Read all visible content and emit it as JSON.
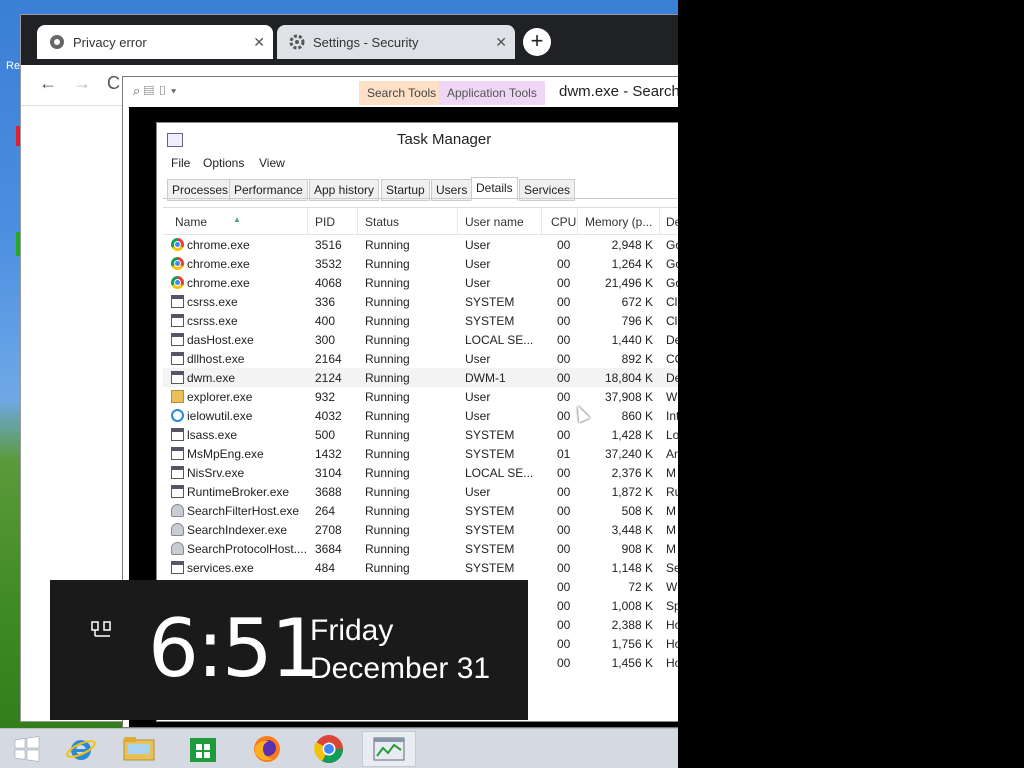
{
  "desktop": {
    "label": "Re"
  },
  "browser": {
    "tabs": [
      {
        "label": "Privacy error",
        "active": true
      },
      {
        "label": "Settings - Security",
        "active": false
      }
    ],
    "new_tab": "+",
    "nav": {
      "back": "←",
      "forward": "→",
      "reload": "C"
    }
  },
  "explorer": {
    "ribbon_tabs": [
      "Search Tools",
      "Application Tools"
    ],
    "title": "dwm.exe - Search"
  },
  "task_manager": {
    "title": "Task Manager",
    "menu": [
      "File",
      "Options",
      "View"
    ],
    "tabs": [
      "Processes",
      "Performance",
      "App history",
      "Startup",
      "Users",
      "Details",
      "Services"
    ],
    "active_tab": "Details",
    "columns": [
      "Name",
      "PID",
      "Status",
      "User name",
      "CPU",
      "Memory (p...",
      "De"
    ],
    "rows": [
      {
        "name": "chrome.exe",
        "icon": "chrome-icon",
        "pid": "3516",
        "status": "Running",
        "user": "User",
        "cpu": "00",
        "mem": "2,948 K",
        "desc": "Go"
      },
      {
        "name": "chrome.exe",
        "icon": "chrome-icon",
        "pid": "3532",
        "status": "Running",
        "user": "User",
        "cpu": "00",
        "mem": "1,264 K",
        "desc": "Go"
      },
      {
        "name": "chrome.exe",
        "icon": "chrome-icon",
        "pid": "4068",
        "status": "Running",
        "user": "User",
        "cpu": "00",
        "mem": "21,496 K",
        "desc": "Go"
      },
      {
        "name": "csrss.exe",
        "icon": "window-icon",
        "pid": "336",
        "status": "Running",
        "user": "SYSTEM",
        "cpu": "00",
        "mem": "672 K",
        "desc": "Cl"
      },
      {
        "name": "csrss.exe",
        "icon": "window-icon",
        "pid": "400",
        "status": "Running",
        "user": "SYSTEM",
        "cpu": "00",
        "mem": "796 K",
        "desc": "Cl"
      },
      {
        "name": "dasHost.exe",
        "icon": "window-icon",
        "pid": "300",
        "status": "Running",
        "user": "LOCAL SE...",
        "cpu": "00",
        "mem": "1,440 K",
        "desc": "De"
      },
      {
        "name": "dllhost.exe",
        "icon": "window-icon",
        "pid": "2164",
        "status": "Running",
        "user": "User",
        "cpu": "00",
        "mem": "892 K",
        "desc": "CO"
      },
      {
        "name": "dwm.exe",
        "icon": "window-icon",
        "pid": "2124",
        "status": "Running",
        "user": "DWM-1",
        "cpu": "00",
        "mem": "18,804 K",
        "desc": "De",
        "selected": true
      },
      {
        "name": "explorer.exe",
        "icon": "folder-icon",
        "pid": "932",
        "status": "Running",
        "user": "User",
        "cpu": "00",
        "mem": "37,908 K",
        "desc": "W"
      },
      {
        "name": "ielowutil.exe",
        "icon": "ie-icon",
        "pid": "4032",
        "status": "Running",
        "user": "User",
        "cpu": "00",
        "mem": "860 K",
        "desc": "Int"
      },
      {
        "name": "lsass.exe",
        "icon": "window-icon",
        "pid": "500",
        "status": "Running",
        "user": "SYSTEM",
        "cpu": "00",
        "mem": "1,428 K",
        "desc": "Lo"
      },
      {
        "name": "MsMpEng.exe",
        "icon": "window-icon",
        "pid": "1432",
        "status": "Running",
        "user": "SYSTEM",
        "cpu": "01",
        "mem": "37,240 K",
        "desc": "An"
      },
      {
        "name": "NisSrv.exe",
        "icon": "window-icon",
        "pid": "3104",
        "status": "Running",
        "user": "LOCAL SE...",
        "cpu": "00",
        "mem": "2,376 K",
        "desc": "M"
      },
      {
        "name": "RuntimeBroker.exe",
        "icon": "window-icon",
        "pid": "3688",
        "status": "Running",
        "user": "User",
        "cpu": "00",
        "mem": "1,872 K",
        "desc": "Ru"
      },
      {
        "name": "SearchFilterHost.exe",
        "icon": "person-icon",
        "pid": "264",
        "status": "Running",
        "user": "SYSTEM",
        "cpu": "00",
        "mem": "508 K",
        "desc": "M"
      },
      {
        "name": "SearchIndexer.exe",
        "icon": "person-icon",
        "pid": "2708",
        "status": "Running",
        "user": "SYSTEM",
        "cpu": "00",
        "mem": "3,448 K",
        "desc": "M"
      },
      {
        "name": "SearchProtocolHost....",
        "icon": "person-icon",
        "pid": "3684",
        "status": "Running",
        "user": "SYSTEM",
        "cpu": "00",
        "mem": "908 K",
        "desc": "M"
      },
      {
        "name": "services.exe",
        "icon": "window-icon",
        "pid": "484",
        "status": "Running",
        "user": "SYSTEM",
        "cpu": "00",
        "mem": "1,148 K",
        "desc": "Se"
      },
      {
        "name": "",
        "icon": "",
        "pid": "",
        "status": "",
        "user": "",
        "cpu": "00",
        "mem": "72 K",
        "desc": "W"
      },
      {
        "name": "",
        "icon": "",
        "pid": "",
        "status": "",
        "user": "",
        "cpu": "00",
        "mem": "1,008 K",
        "desc": "Sp"
      },
      {
        "name": "",
        "icon": "",
        "pid": "",
        "status": "",
        "user": "",
        "cpu": "00",
        "mem": "2,388 K",
        "desc": "Ho"
      },
      {
        "name": "",
        "icon": "",
        "pid": "",
        "status": "",
        "user": "",
        "cpu": "00",
        "mem": "1,756 K",
        "desc": "Ho"
      },
      {
        "name": "",
        "icon": "",
        "pid": "",
        "status": "",
        "user": "",
        "cpu": "00",
        "mem": "1,456 K",
        "desc": "Ho"
      }
    ]
  },
  "clock": {
    "time": "6:51",
    "day": "Friday",
    "date": "December 31"
  },
  "taskbar": {
    "items": [
      {
        "name": "start-button",
        "icon": "windows-logo-icon"
      },
      {
        "name": "taskbar-internet-explorer",
        "icon": "ie-icon"
      },
      {
        "name": "taskbar-file-explorer",
        "icon": "folder-icon"
      },
      {
        "name": "taskbar-store",
        "icon": "store-icon"
      },
      {
        "name": "taskbar-firefox",
        "icon": "firefox-icon"
      },
      {
        "name": "taskbar-chrome",
        "icon": "chrome-icon"
      },
      {
        "name": "taskbar-task-manager",
        "icon": "task-manager-icon",
        "active": true
      }
    ]
  }
}
